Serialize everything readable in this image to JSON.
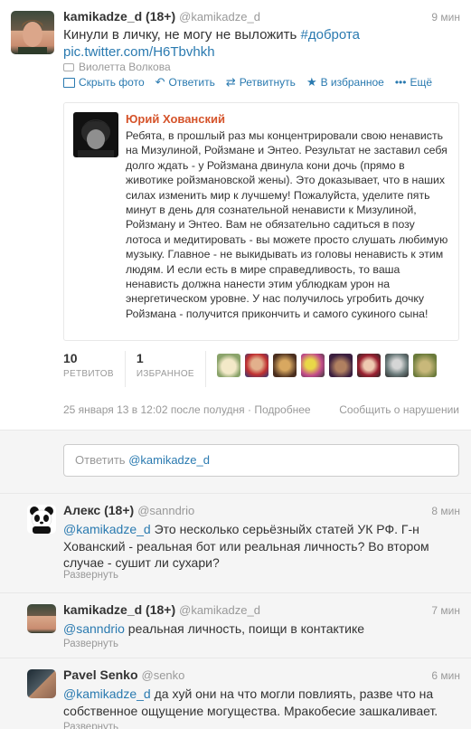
{
  "main_tweet": {
    "name": "kamikadze_d (18+)",
    "handle": "@kamikadze_d",
    "time": "9 мин",
    "text": "Кинули в личку, не могу не выложить",
    "hashtag": "#доброта",
    "link": "pic.twitter.com/H6Tbvhkh",
    "retweeted_by": "Виолетта Волкова",
    "actions": {
      "hide_photo": "Скрыть фото",
      "reply": "Ответить",
      "retweet": "Ретвитнуть",
      "favorite": "В избранное",
      "more": "Ещё"
    },
    "embed": {
      "author": "Юрий Хованский",
      "text": "Ребята, в прошлый раз мы концентрировали свою ненависть на Мизулиной, Ройзмане и Энтео. Результат не заставил себя долго ждать - у Ройзмана двинула кони дочь (прямо в животике ройзмановской жены). Это доказывает, что в наших силах изменить мир к лучшему! Пожалуйста, уделите пять минут в день для сознательной ненависти к Мизулиной, Ройзману и Энтео. Вам не обязательно садиться в позу лотоса и медитировать - вы можете просто слушать любимую музыку. Главное - не выкидывать из головы ненависть к этим людям. И если есть в мире справедливость, то ваша ненависть должна нанести этим ублюдкам урон на энергетическом уровне. У нас получилось угробить дочку Ройзмана - получится прикончить и самого сукиного сына!"
    },
    "stats": {
      "retweets_count": "10",
      "retweets_label": "РЕТВИТОВ",
      "favorites_count": "1",
      "favorites_label": "ИЗБРАННОЕ"
    },
    "date": "25 января 13 в 12:02 после полудня",
    "source": "· Подробнее",
    "report": "Сообщить о нарушении"
  },
  "reply_box": {
    "prefix": "Ответить ",
    "mention": "@kamikadze_d"
  },
  "replies": [
    {
      "name": "Алекс (18+)",
      "handle": "@sanndrio",
      "time": "8 мин",
      "mention": "@kamikadze_d",
      "text": " Это несколько серьёзныйх статей УК РФ. Г-н Хованский - реальная бот или реальная личность? Во втором случае - сушит ли сухари?",
      "expand": "Развернуть"
    },
    {
      "name": "kamikadze_d (18+)",
      "handle": "@kamikadze_d",
      "time": "7 мин",
      "mention": "@sanndrio",
      "text": " реальная личность, поищи в контактике",
      "expand": "Развернуть"
    },
    {
      "name": "Pavel Senko",
      "handle": "@senko",
      "time": "6 мин",
      "mention": "@kamikadze_d",
      "text": " да хуй они на что могли повлиять, разве что на собственное ощущение могущества. Мракобесие зашкаливает.",
      "expand": "Развернуть"
    }
  ],
  "colors": {
    "link": "#2a7ab0",
    "embed_author": "#d5532a",
    "reply_bg": "#f5f5f5"
  }
}
